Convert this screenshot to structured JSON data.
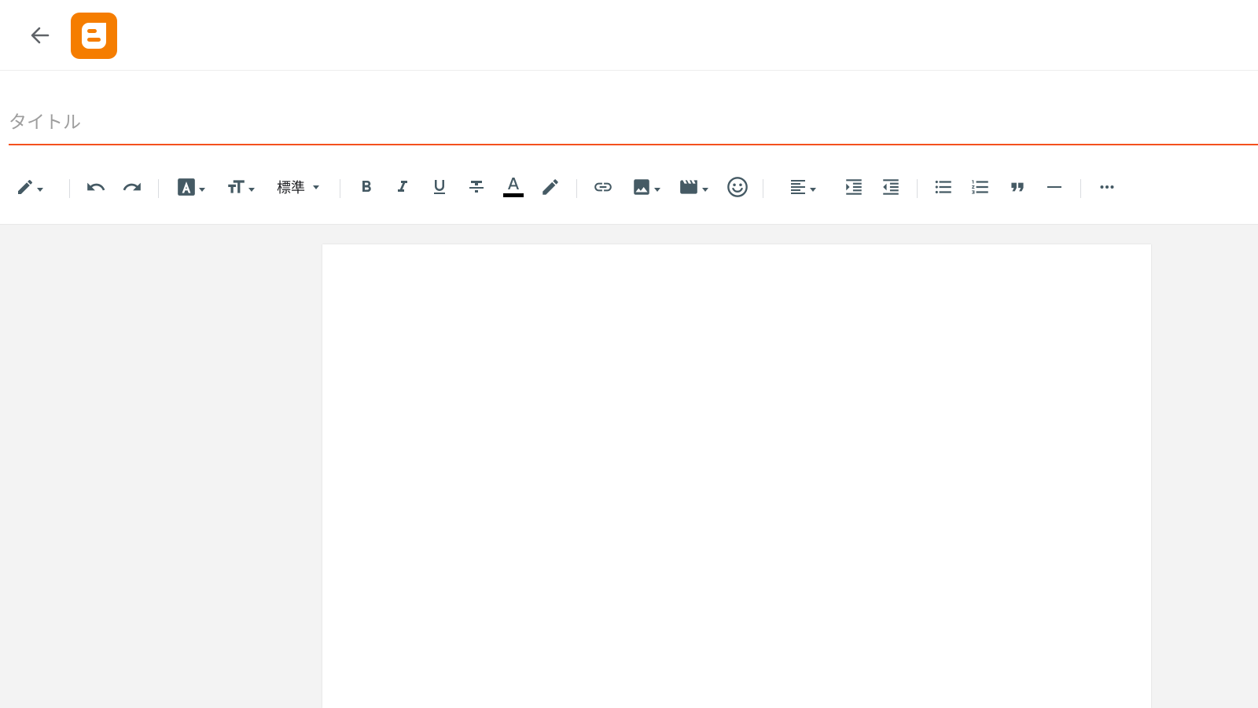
{
  "header": {
    "back_icon": "arrow-left-icon",
    "logo": "blogger-logo",
    "brand_color": "#f57d00"
  },
  "title": {
    "placeholder": "タイトル",
    "value": "",
    "underline_color": "#f4511e"
  },
  "toolbar": {
    "icon_color": "#455a64",
    "paragraph_format": "標準",
    "text_color_swatch": "#000000",
    "items": [
      "pencil-mode-icon",
      "undo-icon",
      "redo-icon",
      "font-family-icon",
      "font-size-icon",
      "paragraph-format-select",
      "bold-icon",
      "italic-icon",
      "underline-icon",
      "strikethrough-icon",
      "text-color-icon",
      "highlight-icon",
      "link-icon",
      "image-icon",
      "video-icon",
      "emoji-icon",
      "align-icon",
      "indent-increase-icon",
      "indent-decrease-icon",
      "bulleted-list-icon",
      "numbered-list-icon",
      "quote-icon",
      "horizontal-rule-icon",
      "more-icon"
    ]
  },
  "editor": {
    "body_text": ""
  }
}
